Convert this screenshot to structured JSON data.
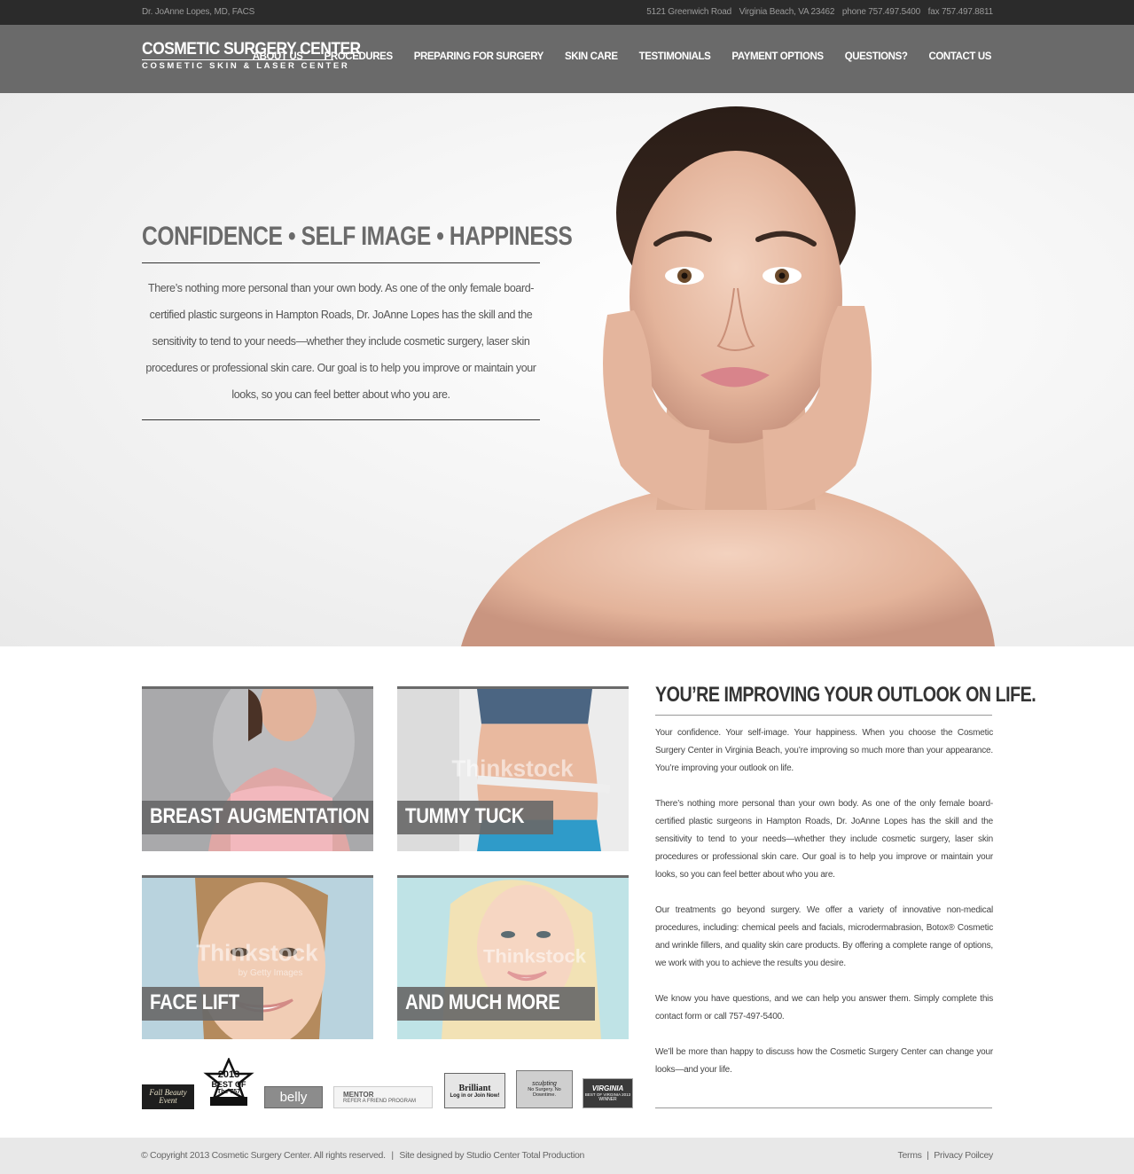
{
  "topbar": {
    "doctor": "Dr. JoAnne Lopes, MD, FACS",
    "address": "5121 Greenwich Road",
    "city": "Virginia Beach, VA 23462",
    "phone": "phone 757.497.5400",
    "fax": "fax 757.497.8811"
  },
  "logo": {
    "line1": "COSMETIC SURGERY CENTER",
    "line2": "COSMETIC SKIN & LASER CENTER"
  },
  "nav": [
    {
      "label": "ABOUT US"
    },
    {
      "label": "PROCEDURES"
    },
    {
      "label": "PREPARING FOR SURGERY"
    },
    {
      "label": "SKIN CARE"
    },
    {
      "label": "TESTIMONIALS"
    },
    {
      "label": "PAYMENT OPTIONS"
    },
    {
      "label": "QUESTIONS?"
    },
    {
      "label": "CONTACT US"
    }
  ],
  "hero": {
    "title": "CONFIDENCE  •  SELF IMAGE  •  HAPPINESS",
    "text": "There’s nothing more personal than your own body. As one of the only female board-certified plastic surgeons in Hampton Roads, Dr. JoAnne Lopes has the skill and the sensitivity to tend to your needs—whether they include cosmetic surgery, laser skin procedures or professional skin care. Our goal is to help you improve or maintain your looks, so you can feel better about who you are."
  },
  "tiles": [
    {
      "label": "BREAST AUGMENTATION"
    },
    {
      "label": "TUMMY TUCK"
    },
    {
      "label": "FACE LIFT"
    },
    {
      "label": "AND MUCH MORE"
    }
  ],
  "watermark": "Thinkstock",
  "watermark_sub": "by Getty Images",
  "outlook": {
    "title": "YOU’RE IMPROVING YOUR OUTLOOK ON LIFE.",
    "paragraphs": [
      "Your confidence. Your self-image. Your happiness. When you choose the Cosmetic Surgery Center in Virginia Beach, you’re improving so much more than your appearance. You’re improving your outlook on life.",
      "There’s nothing more personal than your own body. As one of the only female board-certified plastic surgeons in Hampton Roads, Dr. JoAnne Lopes has the skill and the sensitivity to tend to your needs—whether they include cosmetic surgery, laser skin procedures or professional skin care. Our goal is to help you improve or maintain your looks, so you can feel better about who you are.",
      "Our treatments go beyond surgery. We offer a variety of innovative non-medical procedures, including: chemical peels and facials, microdermabrasion, Botox® Cosmetic and wrinkle fillers, and quality skin care products. By offering a complete range of options, we work with you to achieve the results you desire.",
      "We know you have questions, and we can help you answer them. Simply complete this contact form or call 757-497-5400.",
      "We’ll be more than happy to discuss how the Cosmetic Surgery Center can change your looks—and your life."
    ]
  },
  "badges": {
    "fall": "Fall Beauty Event",
    "best_year": "2013",
    "best_label": "BEST OF",
    "best_sub": "The 757",
    "belly": "belly",
    "mentor_title": "MENTOR",
    "mentor_sub": "REFER A FRIEND PROGRAM",
    "brilliant_title": "Brilliant",
    "brilliant_sub": "Log in or Join Now!",
    "sculpt_title": "sculpting",
    "sculpt_sub": "No Surgery. No Downtime.",
    "virginia_title": "VIRGINIA",
    "virginia_sub": "BEST OF VIRGINIA 2013",
    "virginia_winner": "WINNER"
  },
  "footer": {
    "copyright": "© Copyright 2013 Cosmetic Surgery Center. All rights reserved.",
    "separator": "|",
    "designed": "Site designed by Studio Center Total Production",
    "terms": "Terms",
    "privacy": "Privacy Poilcey"
  },
  "colors": {
    "topbar": "#2b2b2b",
    "header": "#6a6a6a",
    "label_bg": "#696969",
    "footer": "#e8e8e8"
  }
}
